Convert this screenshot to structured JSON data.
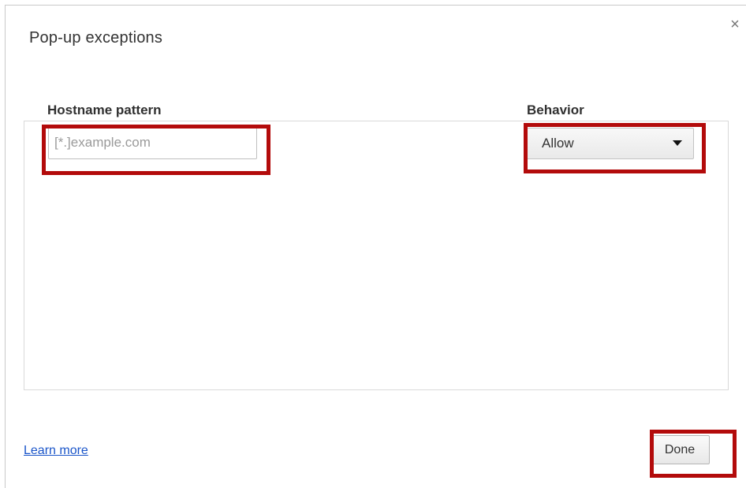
{
  "dialog": {
    "title": "Pop-up exceptions",
    "close_icon": "close-icon",
    "close_glyph": "×"
  },
  "columns": {
    "hostname_header": "Hostname pattern",
    "behavior_header": "Behavior"
  },
  "new_exception": {
    "hostname_placeholder": "[*.]example.com",
    "hostname_value": "",
    "behavior_selected": "Allow"
  },
  "footer": {
    "learn_more": "Learn more",
    "done_label": "Done"
  },
  "colors": {
    "highlight": "#b30b0b",
    "link": "#1a55c9"
  }
}
